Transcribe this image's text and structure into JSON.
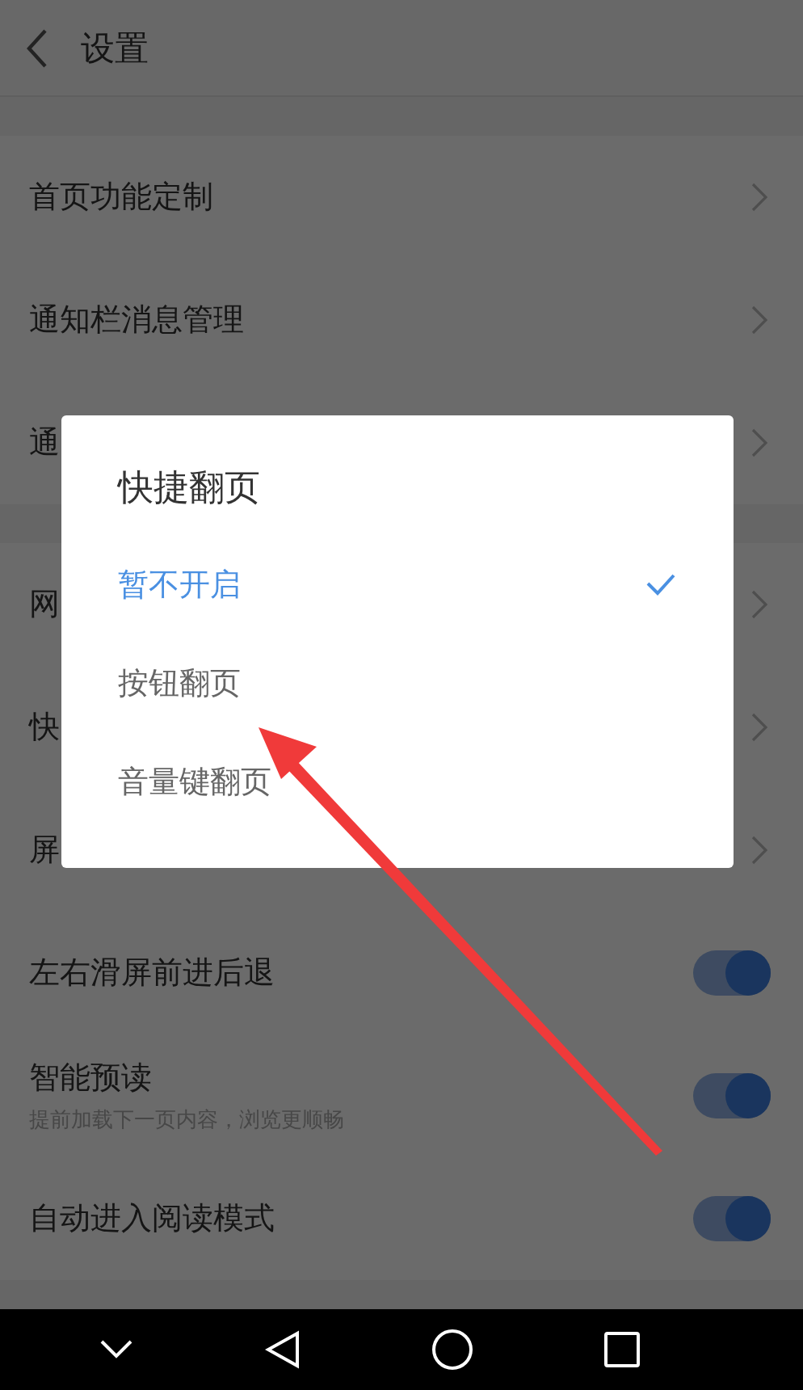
{
  "header": {
    "title": "设置"
  },
  "groups": [
    {
      "items": [
        {
          "kind": "link",
          "label": "首页功能定制"
        },
        {
          "kind": "link",
          "label": "通知栏消息管理"
        },
        {
          "kind": "link",
          "label": "通"
        }
      ]
    },
    {
      "items": [
        {
          "kind": "link",
          "label": "网"
        },
        {
          "kind": "link",
          "label": "快"
        },
        {
          "kind": "link",
          "label": "屏"
        },
        {
          "kind": "toggle",
          "label": "左右滑屏前进后退",
          "on": true
        },
        {
          "kind": "toggle",
          "label": "智能预读",
          "subtitle": "提前加载下一页内容，浏览更顺畅",
          "on": true
        },
        {
          "kind": "toggle",
          "label": "自动进入阅读模式",
          "on": true
        }
      ]
    }
  ],
  "dialog": {
    "title": "快捷翻页",
    "options": [
      {
        "label": "暂不开启",
        "selected": true
      },
      {
        "label": "按钮翻页",
        "selected": false
      },
      {
        "label": "音量键翻页",
        "selected": false
      }
    ]
  }
}
